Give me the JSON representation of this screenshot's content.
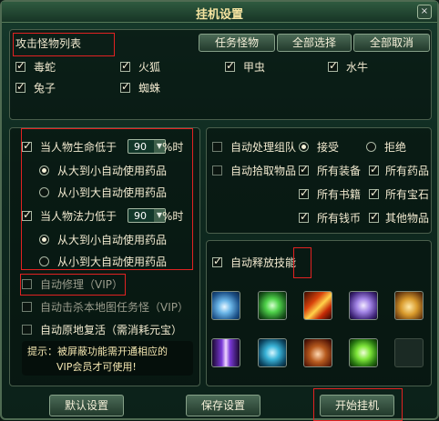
{
  "window": {
    "title": "挂机设置",
    "close_glyph": "×"
  },
  "monsters": {
    "header": "攻击怪物列表",
    "buttons": {
      "task": "任务怪物",
      "select_all": "全部选择",
      "cancel_all": "全部取消"
    },
    "items": [
      {
        "label": "毒蛇",
        "checked": true
      },
      {
        "label": "火狐",
        "checked": true
      },
      {
        "label": "甲虫",
        "checked": true
      },
      {
        "label": "水牛",
        "checked": true
      },
      {
        "label": "兔子",
        "checked": true
      },
      {
        "label": "蜘蛛",
        "checked": true
      }
    ]
  },
  "potions": {
    "hp": {
      "prefix": "当人物生命低于",
      "value": "90",
      "suffix": "%时"
    },
    "hp_big_first": "从大到小自动使用药品",
    "hp_small_first": "从小到大自动使用药品",
    "mp": {
      "prefix": "当人物法力低于",
      "value": "90",
      "suffix": "%时"
    },
    "mp_big_first": "从大到小自动使用药品",
    "mp_small_first": "从小到大自动使用药品"
  },
  "vip": {
    "repair": "自动修理（VIP）",
    "kill_all": "自动击杀本地图任务怪（VIP）",
    "revive": "自动原地复活（需消耗元宝）",
    "tip_line1": "提示：被屏蔽功能需开通相应的",
    "tip_line2": "VIP会员才可使用!"
  },
  "team": {
    "label": "自动处理组队",
    "accept": "接受",
    "refuse": "拒绝"
  },
  "pickup": {
    "label": "自动拾取物品",
    "items": [
      "所有装备",
      "所有药品",
      "所有书籍",
      "所有宝石",
      "所有钱币",
      "其他物品"
    ]
  },
  "skills": {
    "label": "自动释放技能",
    "icons": [
      "hand-skill-icon",
      "green-skull-icon",
      "fire-slash-icon",
      "skull-spirit-icon",
      "lion-head-icon",
      "purple-beam-icon",
      "hexagram-icon",
      "beast-roar-icon",
      "green-burst-icon",
      "empty-skill-slot"
    ]
  },
  "footer": {
    "default": "默认设置",
    "save": "保存设置",
    "start": "开始挂机"
  }
}
